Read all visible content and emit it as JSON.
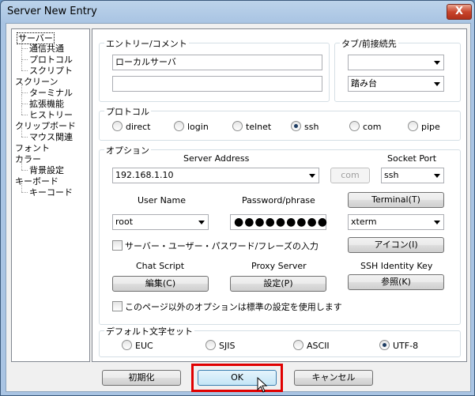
{
  "window": {
    "title": "Server New Entry",
    "close": "X"
  },
  "tree": {
    "items": [
      {
        "label": "サーバー",
        "level": 0
      },
      {
        "label": "通信共通",
        "level": 1
      },
      {
        "label": "プロトコル",
        "level": 1
      },
      {
        "label": "スクリプト",
        "level": 1
      },
      {
        "label": "スクリーン",
        "level": 0
      },
      {
        "label": "ターミナル",
        "level": 1
      },
      {
        "label": "拡張機能",
        "level": 1
      },
      {
        "label": "ヒストリー",
        "level": 1
      },
      {
        "label": "クリップボード",
        "level": 0
      },
      {
        "label": "マウス関連",
        "level": 1
      },
      {
        "label": "フォント",
        "level": 0
      },
      {
        "label": "カラー",
        "level": 0
      },
      {
        "label": "背景設定",
        "level": 1
      },
      {
        "label": "キーボード",
        "level": 0
      },
      {
        "label": "キーコード",
        "level": 1
      }
    ]
  },
  "entry": {
    "title": "エントリー/コメント",
    "name_value": "ローカルサーバ",
    "comment_value": ""
  },
  "tab": {
    "title": "タブ/前接続先",
    "tab_value": "",
    "previous_value": "踏み台"
  },
  "protocol": {
    "title": "プロトコル",
    "options": [
      "direct",
      "login",
      "telnet",
      "ssh",
      "com",
      "pipe"
    ],
    "selected": "ssh"
  },
  "options": {
    "title": "オプション",
    "server_address_label": "Server Address",
    "server_address_value": "192.168.1.10",
    "com_button": "com",
    "socket_port_label": "Socket Port",
    "socket_port_value": "ssh",
    "user_name_label": "User Name",
    "user_name_value": "root",
    "password_label": "Password/phrase",
    "password_value": "●●●●●●●●●",
    "terminal_button": "Terminal(T)",
    "terminal_value": "xterm",
    "input_checkbox_label": "サーバー・ユーザー・パスワード/フレーズの入力",
    "icon_button": "アイコン(I)",
    "chat_script_label": "Chat Script",
    "proxy_server_label": "Proxy Server",
    "ssh_identity_label": "SSH Identity Key",
    "edit_button": "編集(C)",
    "setting_button": "設定(P)",
    "browse_button": "参照(K)",
    "default_checkbox_label": "このページ以外のオプションは標準の設定を使用します"
  },
  "charset": {
    "title": "デフォルト文字セット",
    "options": [
      "EUC",
      "SJIS",
      "ASCII",
      "UTF-8"
    ],
    "selected": "UTF-8"
  },
  "footer": {
    "reset_button": "初期化",
    "ok_button": "OK",
    "cancel_button": "キャンセル"
  },
  "colors": {
    "highlight": "#e00000",
    "title_bar": "#a9c4e3"
  }
}
